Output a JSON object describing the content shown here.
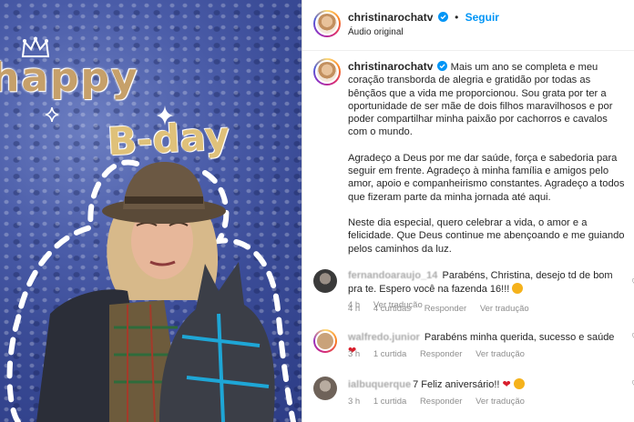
{
  "image": {
    "happy_text": "happy",
    "bday_text": "B-day"
  },
  "header": {
    "username": "christinarochatv",
    "separator": "•",
    "follow_label": "Seguir",
    "audio_label": "Áudio original"
  },
  "caption": {
    "username": "christinarochatv",
    "paragraphs": [
      "Mais um ano se completa e meu coração transborda de alegria e gratidão por todas as bênçãos que a vida me proporcionou. Sou grata por ter a oportunidade de ser mãe de dois filhos maravilhosos e por poder compartilhar minha paixão por cachorros e cavalos com o mundo.",
      "Agradeço a Deus por me dar saúde, força e sabedoria para seguir em frente. Agradeço à minha família e amigos pelo amor, apoio e companheirismo constantes. Agradeço a todos que fizeram parte da minha jornada até aqui.",
      "Neste dia especial, quero celebrar a vida, o amor e a felicidade. Que Deus continue me abençoando e me guiando pelos caminhos da luz."
    ],
    "time": "4 h",
    "translate": "Ver tradução"
  },
  "comments": [
    {
      "username": "fernandoaraujo_14",
      "text": "Parabéns, Christina, desejo td de bom pra te. Espero você na fazenda 16!!!",
      "time": "4 h",
      "likes": "4 curtidas",
      "reply": "Responder",
      "translate": "Ver tradução",
      "emoji_color": "#f5b21b"
    },
    {
      "username": "walfredo.junior",
      "text": "Parabéns minha querida, sucesso e saúde",
      "time": "3 h",
      "likes": "1 curtida",
      "reply": "Responder",
      "translate": "Ver tradução",
      "emoji_color": "#d81e2c"
    },
    {
      "username": "ialbuquerque",
      "text": "7 Feliz aniversário!!",
      "time": "3 h",
      "likes": "1 curtida",
      "reply": "Responder",
      "translate": "Ver tradução",
      "emoji_color": "#d81e2c"
    }
  ],
  "colors": {
    "accent": "#0095f6",
    "secondary_text": "#8e8e8e",
    "image_background": "#3a4b96"
  }
}
